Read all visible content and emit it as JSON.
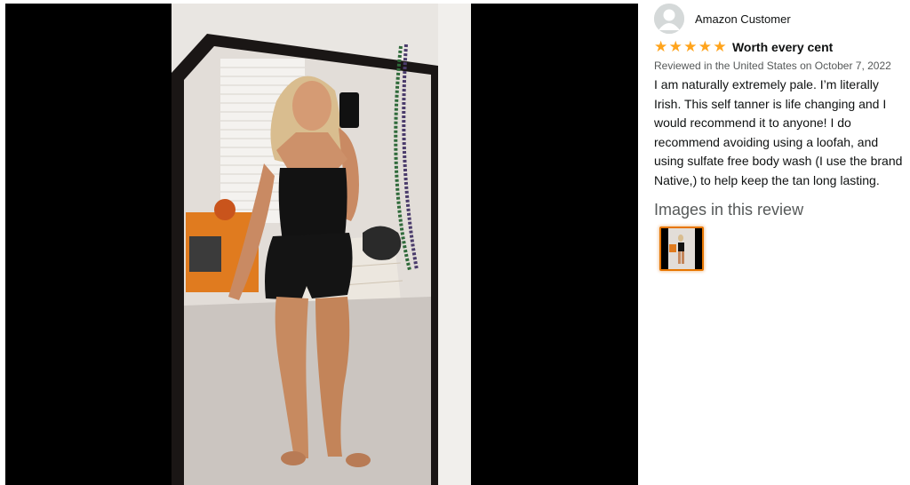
{
  "viewer": {
    "image_alt": "Customer review photo"
  },
  "review": {
    "reviewer_name": "Amazon Customer",
    "rating": 5,
    "rating_max": 5,
    "star_glyph": "★",
    "title": "Worth every cent",
    "date_line": "Reviewed in the United States on October 7, 2022",
    "body": "I am naturally extremely pale. I’m literally Irish. This self tanner is life changing and I would recommend it to anyone! I do recommend avoiding using a loofah, and using sulfate free body wash (I use the brand Native,) to help keep the tan long lasting.",
    "images_heading": "Images in this review"
  },
  "colors": {
    "star": "#ffa41c",
    "thumb_border": "#e77600",
    "secondary_text": "#565959"
  },
  "icons": {
    "avatar": "default-user-avatar-icon",
    "star": "star-icon"
  }
}
